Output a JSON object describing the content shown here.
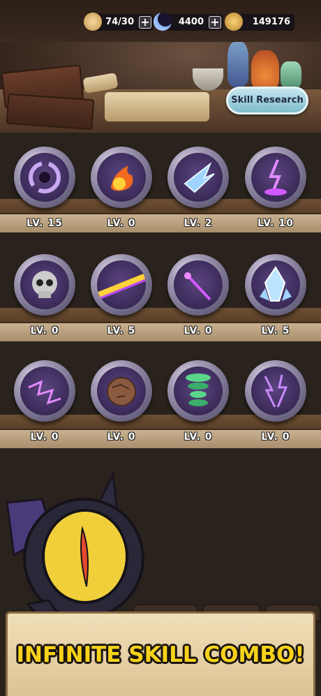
{
  "resources": {
    "energy": {
      "icon": "sandwich-icon",
      "value": "74/30"
    },
    "moon": {
      "icon": "moon-icon",
      "value": "4400"
    },
    "gold": {
      "icon": "coin-icon",
      "value": "149176"
    }
  },
  "research_button": "Skill Research",
  "skills": [
    {
      "icon": "vortex-icon",
      "level": "LV. 15"
    },
    {
      "icon": "fireball-icon",
      "level": "LV. 0"
    },
    {
      "icon": "ice-shard-icon",
      "level": "LV. 2"
    },
    {
      "icon": "lightning-strike-icon",
      "level": "LV. 10"
    },
    {
      "icon": "skull-icon",
      "level": "LV. 0"
    },
    {
      "icon": "laser-beam-icon",
      "level": "LV. 5"
    },
    {
      "icon": "magic-wand-icon",
      "level": "LV. 0"
    },
    {
      "icon": "crystal-icon",
      "level": "LV. 5"
    },
    {
      "icon": "electric-web-icon",
      "level": "LV. 0"
    },
    {
      "icon": "boulder-icon",
      "level": "LV. 0"
    },
    {
      "icon": "tornado-icon",
      "level": "LV. 0"
    },
    {
      "icon": "storm-icon",
      "level": "LV. 0"
    }
  ],
  "banner": "INFINITE SKILL COMBO!",
  "colors": {
    "banner_text": "#f7d21a",
    "research_button": "#a8d8e4",
    "orb_inner": "#3a2a58"
  }
}
